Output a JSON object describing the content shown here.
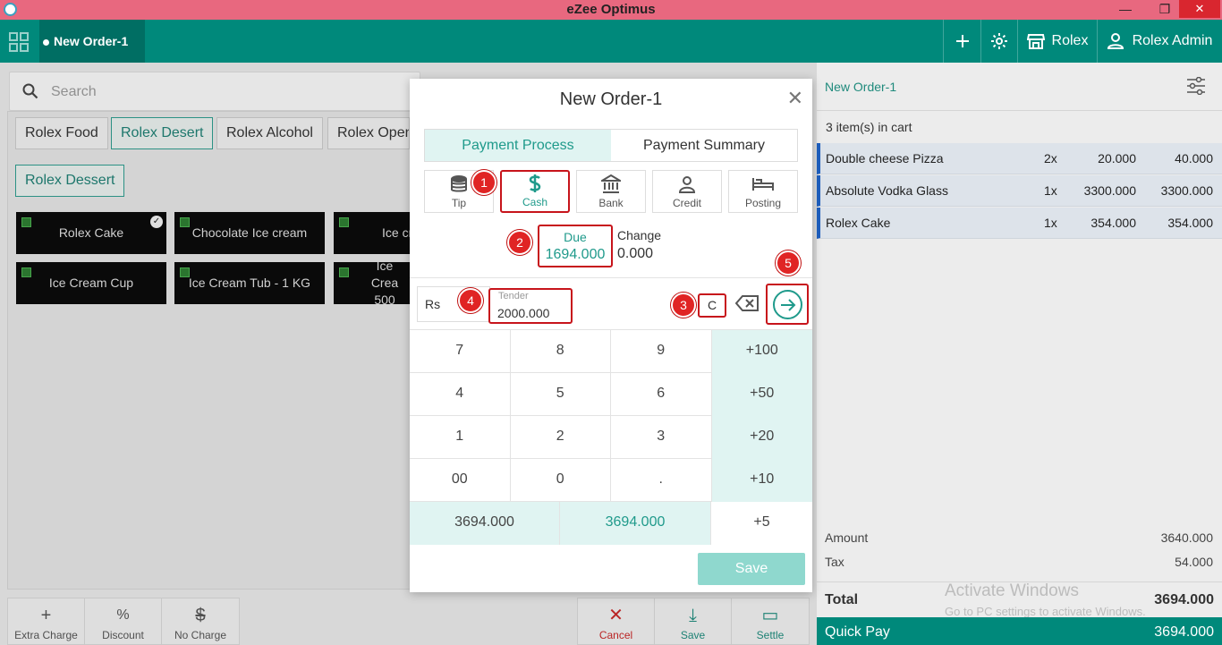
{
  "window": {
    "title": "eZee Optimus",
    "minimize": "—",
    "restore": "❐",
    "close": "✕"
  },
  "header": {
    "order_tab": "New Order-1",
    "outlet": "Rolex",
    "user": "Rolex Admin"
  },
  "search": {
    "placeholder": "Search"
  },
  "categories": [
    "Rolex Food",
    "Rolex Desert",
    "Rolex Alcohol",
    "Rolex Open"
  ],
  "subcategory": "Rolex Dessert",
  "items": [
    "Rolex Cake",
    "Chocolate Ice cream",
    "Ice cr",
    "Ice Cream Cup",
    "Ice Cream Tub - 1 KG",
    "Ice Crea 500"
  ],
  "bottom_left": [
    {
      "icon": "+",
      "label": "Extra Charge"
    },
    {
      "icon": "%",
      "label": "Discount"
    },
    {
      "icon": "$",
      "label": "No Charge"
    }
  ],
  "bottom_right": [
    {
      "icon": "✕",
      "label": "Cancel"
    },
    {
      "icon": "⤓",
      "label": "Save"
    },
    {
      "icon": "▭",
      "label": "Settle"
    }
  ],
  "cart": {
    "order_name": "New Order-1",
    "count_text": "3 item(s) in cart",
    "rows": [
      {
        "name": "Double cheese Pizza",
        "qty": "2x",
        "price": "20.000",
        "total": "40.000"
      },
      {
        "name": "Absolute Vodka Glass",
        "qty": "1x",
        "price": "3300.000",
        "total": "3300.000"
      },
      {
        "name": "Rolex Cake",
        "qty": "1x",
        "price": "354.000",
        "total": "354.000"
      }
    ],
    "amount_label": "Amount",
    "amount": "3640.000",
    "tax_label": "Tax",
    "tax": "54.000",
    "total_label": "Total",
    "total": "3694.000",
    "quick_pay_label": "Quick Pay",
    "quick_pay": "3694.000",
    "watermark_title": "Activate Windows",
    "watermark_sub": "Go to PC settings to activate Windows."
  },
  "modal": {
    "title": "New Order-1",
    "tabs": [
      "Payment Process",
      "Payment Summary"
    ],
    "methods": [
      "Tip",
      "Cash",
      "Bank",
      "Credit",
      "Posting"
    ],
    "due_label": "Due",
    "due": "1694.000",
    "change_label": "Change",
    "change": "0.000",
    "currency": "Rs",
    "tender_label": "Tender",
    "tender": "2000.000",
    "clear": "C",
    "keys": [
      [
        "7",
        "8",
        "9",
        "+100"
      ],
      [
        "4",
        "5",
        "6",
        "+50"
      ],
      [
        "1",
        "2",
        "3",
        "+20"
      ],
      [
        "00",
        "0",
        ".",
        "+10"
      ]
    ],
    "quick_amounts": [
      "3694.000",
      "3694.000",
      "+5"
    ],
    "save": "Save"
  },
  "badges": [
    "1",
    "2",
    "3",
    "4",
    "5"
  ]
}
